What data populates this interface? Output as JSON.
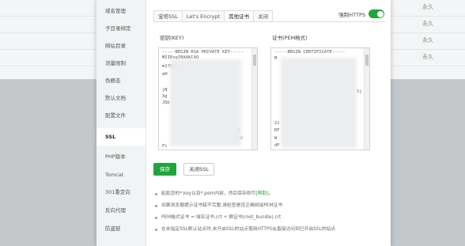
{
  "background": {
    "rows": [
      {
        "permission": "永久"
      },
      {
        "permission": "永久"
      },
      {
        "permission": "永久"
      },
      {
        "permission": "永久"
      }
    ]
  },
  "sidebar": {
    "items": [
      {
        "label": "域名管理",
        "active": false
      },
      {
        "label": "子目录绑定",
        "active": false
      },
      {
        "label": "网站目录",
        "active": false
      },
      {
        "label": "流量限制",
        "active": false
      },
      {
        "label": "伪静态",
        "active": false
      },
      {
        "label": "默认文档",
        "active": false
      },
      {
        "label": "配置文件",
        "active": false
      },
      {
        "label": "SSL",
        "active": true
      },
      {
        "label": "PHP版本",
        "active": false
      },
      {
        "label": "Tomcat",
        "active": false
      },
      {
        "label": "301重定向",
        "active": false
      },
      {
        "label": "反向代理",
        "active": false
      },
      {
        "label": "防盗链",
        "active": false
      }
    ]
  },
  "tabs": [
    {
      "label": "宝塔SSL",
      "active": false
    },
    {
      "label": "Let's Encrypt",
      "active": false
    },
    {
      "label": "其他证书",
      "active": true
    },
    {
      "label": "关闭",
      "active": false
    }
  ],
  "force_https": {
    "label": "强制HTTPS",
    "enabled": true
  },
  "key_field": {
    "label": "密钥(KEY)",
    "visible_lines": [
      "-----BEGIN RSA PRIVATE KEY-----",
      "MIIEogIBAAKCAQ",
      "m17DlE",
      "eH",
      "jN",
      "Xg",
      "JQb",
      "/H",
      "IzV",
      "Fi"
    ]
  },
  "cert_field": {
    "label": "证书(PEM格式)",
    "visible_lines": [
      "-----BEGIN CERTIFICATE-----",
      "M",
      "",
      "",
      "",
      "",
      "5j",
      "",
      "22",
      "RF",
      "W",
      "dF"
    ]
  },
  "buttons": {
    "save": "保存",
    "close_ssl": "关闭SSL"
  },
  "notes": [
    {
      "text": "粘贴您的*.key以及*.pem内容，然后保存即可",
      "link": "[帮助]",
      "suffix": "。"
    },
    {
      "text": "如果浏览器提示证书链不完整,请检查是否正确拼接PEM证书",
      "link": "",
      "suffix": ""
    },
    {
      "text": "PEM格式证书 = 域名证书.crt + 根证书(root_bundle).crt",
      "link": "",
      "suffix": ""
    },
    {
      "text": "在未指定SSL默认站点时,未开启SSL的站点使用HTTPS会直接访问到已开启SSL的站点",
      "link": "",
      "suffix": ""
    }
  ],
  "colors": {
    "accent": "#20a53a",
    "overlay": "#c5c8cb"
  }
}
